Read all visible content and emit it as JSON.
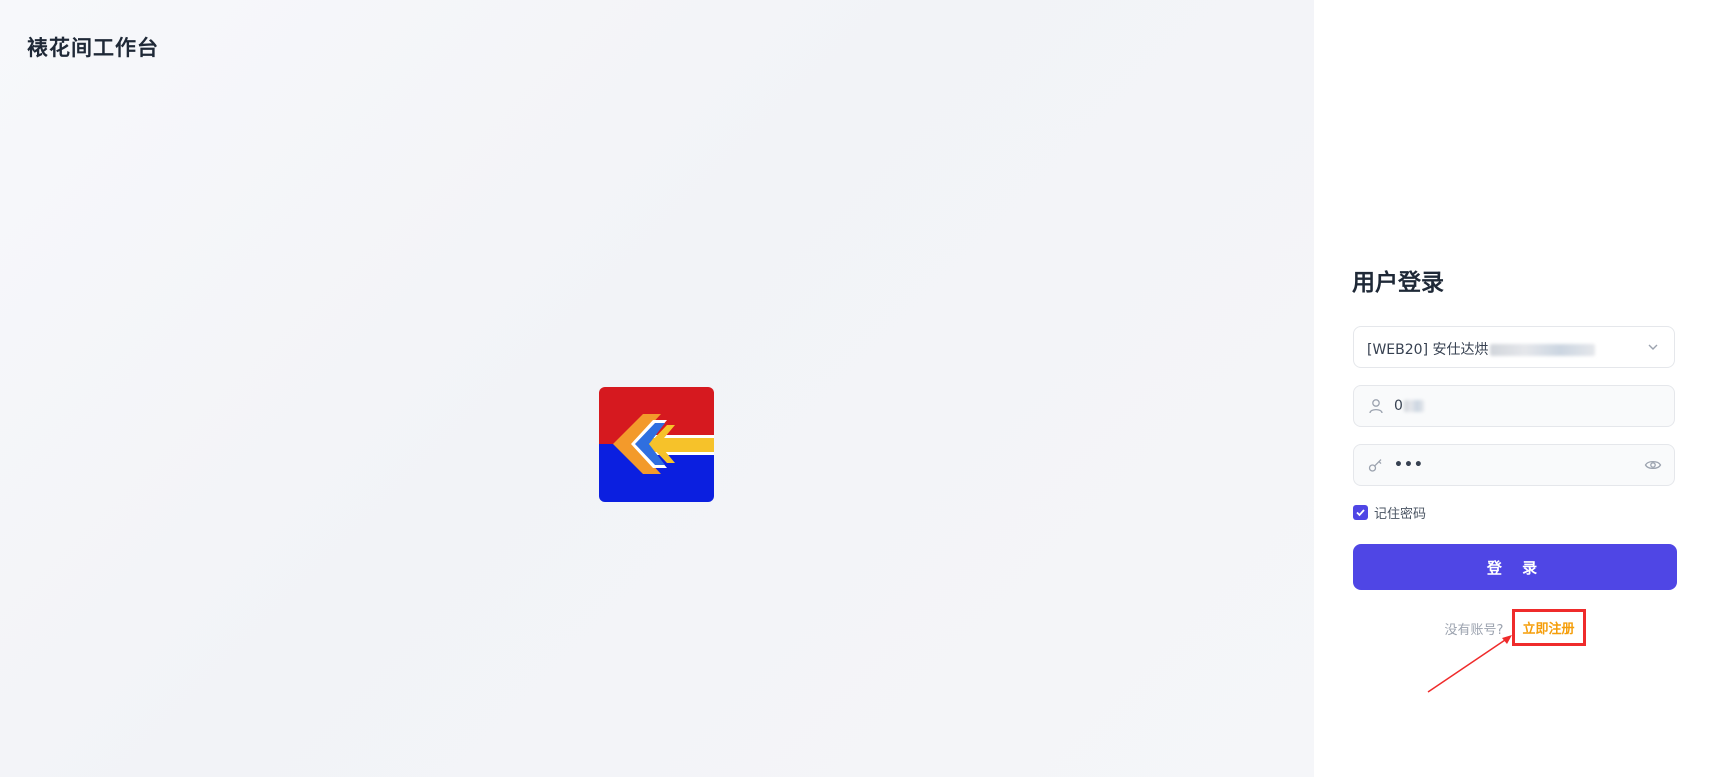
{
  "app": {
    "title": "裱花间工作台"
  },
  "login": {
    "title": "用户登录",
    "org_select_value": "[WEB20] 安仕达烘",
    "username_value": "0",
    "password_value": "•••",
    "remember_label": "记住密码",
    "remember_checked": true,
    "login_button_label": "登 录",
    "no_account_text": "没有账号?",
    "register_link_label": "立即注册"
  },
  "icons": {
    "org_select": "chevron-down-icon",
    "username": "user-icon",
    "password": "key-icon",
    "password_toggle": "eye-icon",
    "remember": "checkmark-icon"
  },
  "colors": {
    "primary": "#4f46e5",
    "register_link": "#f59e0b",
    "annotation": "#ef2b2b",
    "logo_red": "#d6191f",
    "logo_blue": "#0b1fe0",
    "logo_yellow": "#f6c22a",
    "logo_orange": "#f39a2b"
  }
}
